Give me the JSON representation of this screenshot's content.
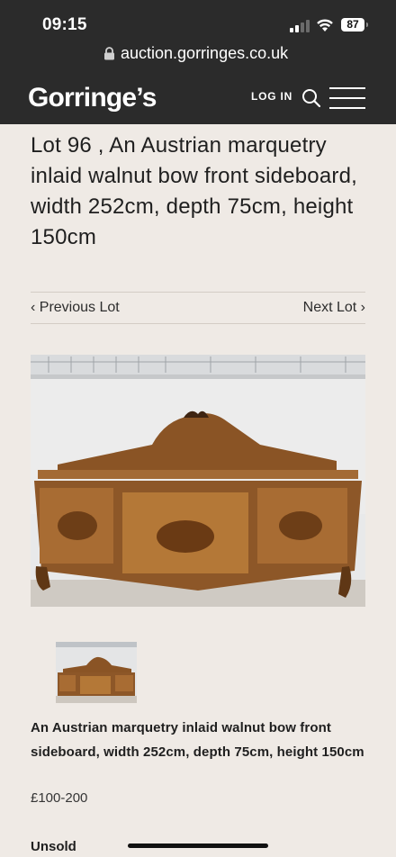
{
  "status_bar": {
    "time": "09:15",
    "battery": "87"
  },
  "browser": {
    "url": "auction.gorringes.co.uk"
  },
  "header": {
    "logo_text": "Gorringe’s",
    "login_label": "LOG IN",
    "search_icon": "search-icon",
    "menu_icon": "hamburger-menu-icon"
  },
  "lot": {
    "title": "Lot 96 , An Austrian marquetry inlaid walnut bow front sideboard, width 252cm, depth 75cm, height 150cm",
    "description": "An Austrian marquetry inlaid walnut bow front sideboard, width 252cm, depth 75cm, height 150cm",
    "estimate": "£100-200",
    "status": "Unsold"
  },
  "navigation": {
    "previous": "‹ Previous Lot",
    "next": "Next Lot ›"
  },
  "colors": {
    "header_bg": "#2b2b2b",
    "page_bg": "#efeae5",
    "text": "#1f1f1f"
  }
}
